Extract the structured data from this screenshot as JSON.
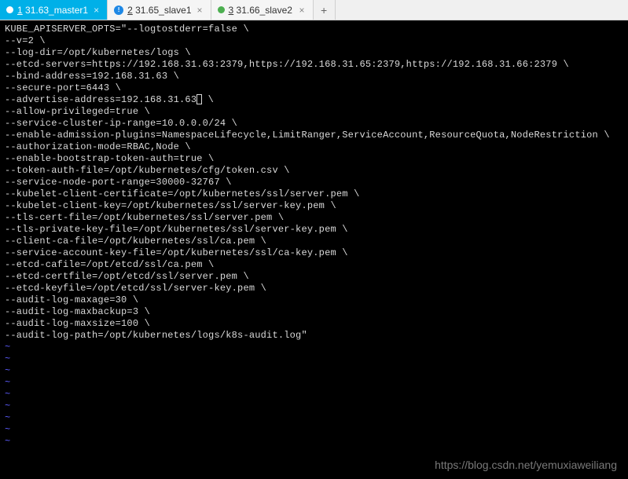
{
  "tabs": [
    {
      "num": "1",
      "label": "31.63_master1",
      "active": true,
      "dot_style": "white"
    },
    {
      "num": "2",
      "label": "31.65_slave1",
      "active": false,
      "dot_style": "blue-info"
    },
    {
      "num": "3",
      "label": "31.66_slave2",
      "active": false,
      "dot_style": "green"
    }
  ],
  "add_label": "+",
  "close_label": "×",
  "terminal_lines": [
    "KUBE_APISERVER_OPTS=\"--logtostderr=false \\",
    "--v=2 \\",
    "--log-dir=/opt/kubernetes/logs \\",
    "--etcd-servers=https://192.168.31.63:2379,https://192.168.31.65:2379,https://192.168.31.66:2379 \\",
    "--bind-address=192.168.31.63 \\",
    "--secure-port=6443 \\",
    "--advertise-address=192.168.31.63",
    "--allow-privileged=true \\",
    "--service-cluster-ip-range=10.0.0.0/24 \\",
    "--enable-admission-plugins=NamespaceLifecycle,LimitRanger,ServiceAccount,ResourceQuota,NodeRestriction \\",
    "--authorization-mode=RBAC,Node \\",
    "--enable-bootstrap-token-auth=true \\",
    "--token-auth-file=/opt/kubernetes/cfg/token.csv \\",
    "--service-node-port-range=30000-32767 \\",
    "--kubelet-client-certificate=/opt/kubernetes/ssl/server.pem \\",
    "--kubelet-client-key=/opt/kubernetes/ssl/server-key.pem \\",
    "--tls-cert-file=/opt/kubernetes/ssl/server.pem \\",
    "--tls-private-key-file=/opt/kubernetes/ssl/server-key.pem \\",
    "--client-ca-file=/opt/kubernetes/ssl/ca.pem \\",
    "--service-account-key-file=/opt/kubernetes/ssl/ca-key.pem \\",
    "--etcd-cafile=/opt/etcd/ssl/ca.pem \\",
    "--etcd-certfile=/opt/etcd/ssl/server.pem \\",
    "--etcd-keyfile=/opt/etcd/ssl/server-key.pem \\",
    "--audit-log-maxage=30 \\",
    "--audit-log-maxbackup=3 \\",
    "--audit-log-maxsize=100 \\",
    "--audit-log-path=/opt/kubernetes/logs/k8s-audit.log\""
  ],
  "cursor_line_index": 6,
  "cursor_suffix": " \\",
  "tilde_count": 9,
  "tilde_char": "~",
  "watermark": "https://blog.csdn.net/yemuxiaweiliang"
}
